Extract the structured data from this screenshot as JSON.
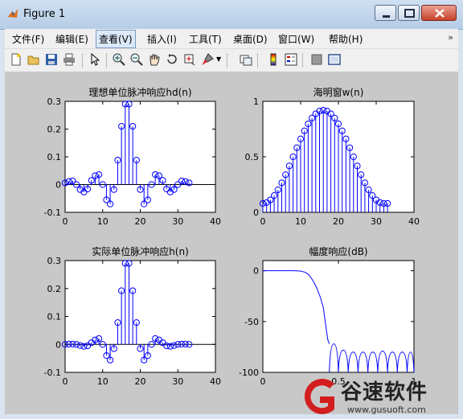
{
  "window": {
    "title": "Figure 1",
    "title_color": "#000000"
  },
  "menu": {
    "items": [
      "文件(F)",
      "编辑(E)",
      "查看(V)",
      "插入(I)",
      "工具(T)",
      "桌面(D)",
      "窗口(W)",
      "帮助(H)"
    ],
    "active_index": 2
  },
  "toolbar": {
    "icons": [
      "new-figure-icon",
      "open-file-icon",
      "save-icon",
      "print-icon",
      "pointer-icon",
      "zoom-in-icon",
      "zoom-out-icon",
      "pan-icon",
      "rotate-3d-icon",
      "data-cursor-icon",
      "brush-icon",
      "link-plot-icon",
      "colorbar-icon",
      "legend-icon",
      "hide-plot-tools-icon",
      "show-plot-tools-icon"
    ]
  },
  "colors": {
    "stem": "#0000ff",
    "figure_bg": "#c8c8c8",
    "axes_bg": "#ffffff"
  },
  "chart_data": [
    {
      "type": "stem",
      "title": "理想单位脉冲响应hd(n)",
      "xlim": [
        0,
        40
      ],
      "ylim": [
        -0.1,
        0.3
      ],
      "xticks": [
        0,
        10,
        20,
        30,
        40
      ],
      "yticks": [
        -0.1,
        0,
        0.1,
        0.2,
        0.3
      ],
      "x": [
        0,
        1,
        2,
        3,
        4,
        5,
        6,
        7,
        8,
        9,
        10,
        11,
        12,
        13,
        14,
        15,
        16,
        17,
        18,
        19,
        20,
        21,
        22,
        23,
        24,
        25,
        26,
        27,
        28,
        29,
        30,
        31,
        32,
        33
      ],
      "values": [
        0.006,
        0.011,
        0.013,
        0.0,
        -0.018,
        -0.027,
        -0.016,
        0.015,
        0.032,
        0.036,
        0.0,
        -0.055,
        -0.07,
        -0.018,
        0.088,
        0.21,
        0.29,
        0.29,
        0.21,
        0.088,
        -0.018,
        -0.07,
        -0.055,
        0.0,
        0.036,
        0.032,
        0.015,
        -0.016,
        -0.027,
        -0.018,
        0.0,
        0.013,
        0.011,
        0.006
      ]
    },
    {
      "type": "stem",
      "title": "海明窗w(n)",
      "xlim": [
        0,
        40
      ],
      "ylim": [
        0,
        1
      ],
      "xticks": [
        0,
        10,
        20,
        30,
        40
      ],
      "yticks": [
        0,
        0.5,
        1
      ],
      "x": [
        0,
        1,
        2,
        3,
        4,
        5,
        6,
        7,
        8,
        9,
        10,
        11,
        12,
        13,
        14,
        15,
        16,
        17,
        18,
        19,
        20,
        21,
        22,
        23,
        24,
        25,
        26,
        27,
        28,
        29,
        30,
        31,
        32,
        33
      ],
      "values": [
        0.08,
        0.088,
        0.112,
        0.151,
        0.203,
        0.266,
        0.339,
        0.418,
        0.5,
        0.582,
        0.661,
        0.734,
        0.797,
        0.849,
        0.888,
        0.912,
        0.92,
        0.912,
        0.888,
        0.849,
        0.797,
        0.734,
        0.661,
        0.582,
        0.5,
        0.418,
        0.339,
        0.266,
        0.203,
        0.151,
        0.112,
        0.088,
        0.08,
        0.08
      ]
    },
    {
      "type": "stem",
      "title": "实际单位脉冲响应h(n)",
      "xlim": [
        0,
        40
      ],
      "ylim": [
        -0.1,
        0.3
      ],
      "xticks": [
        0,
        10,
        20,
        30,
        40
      ],
      "yticks": [
        -0.1,
        0,
        0.1,
        0.2,
        0.3
      ],
      "x": [
        0,
        1,
        2,
        3,
        4,
        5,
        6,
        7,
        8,
        9,
        10,
        11,
        12,
        13,
        14,
        15,
        16,
        17,
        18,
        19,
        20,
        21,
        22,
        23,
        24,
        25,
        26,
        27,
        28,
        29,
        30,
        31,
        32,
        33
      ],
      "values": [
        0.0,
        0.001,
        0.001,
        0.0,
        -0.004,
        -0.007,
        -0.005,
        0.006,
        0.016,
        0.021,
        0.0,
        -0.04,
        -0.056,
        -0.015,
        0.078,
        0.192,
        0.29,
        0.29,
        0.192,
        0.078,
        -0.015,
        -0.056,
        -0.04,
        0.0,
        0.021,
        0.016,
        0.006,
        -0.005,
        -0.007,
        -0.004,
        0.0,
        0.001,
        0.001,
        0.0
      ]
    },
    {
      "type": "line",
      "title": "幅度响应(dB)",
      "xlim": [
        0,
        1
      ],
      "ylim": [
        -100,
        10
      ],
      "xticks": [
        0,
        0.5,
        1
      ],
      "yticks": [
        0,
        -50,
        -100
      ],
      "x": [
        0,
        0.1,
        0.2,
        0.25,
        0.28,
        0.3,
        0.32,
        0.34,
        0.36,
        0.38,
        0.4,
        0.41,
        0.42,
        0.43,
        0.44
      ],
      "values": [
        0,
        0,
        0,
        -0.3,
        -1.5,
        -3.5,
        -7,
        -12,
        -18,
        -26,
        -36,
        -47,
        -58,
        -68,
        -72
      ]
    }
  ],
  "watermark": {
    "brand": "谷速软件",
    "url": "www.gusuoft.com"
  }
}
